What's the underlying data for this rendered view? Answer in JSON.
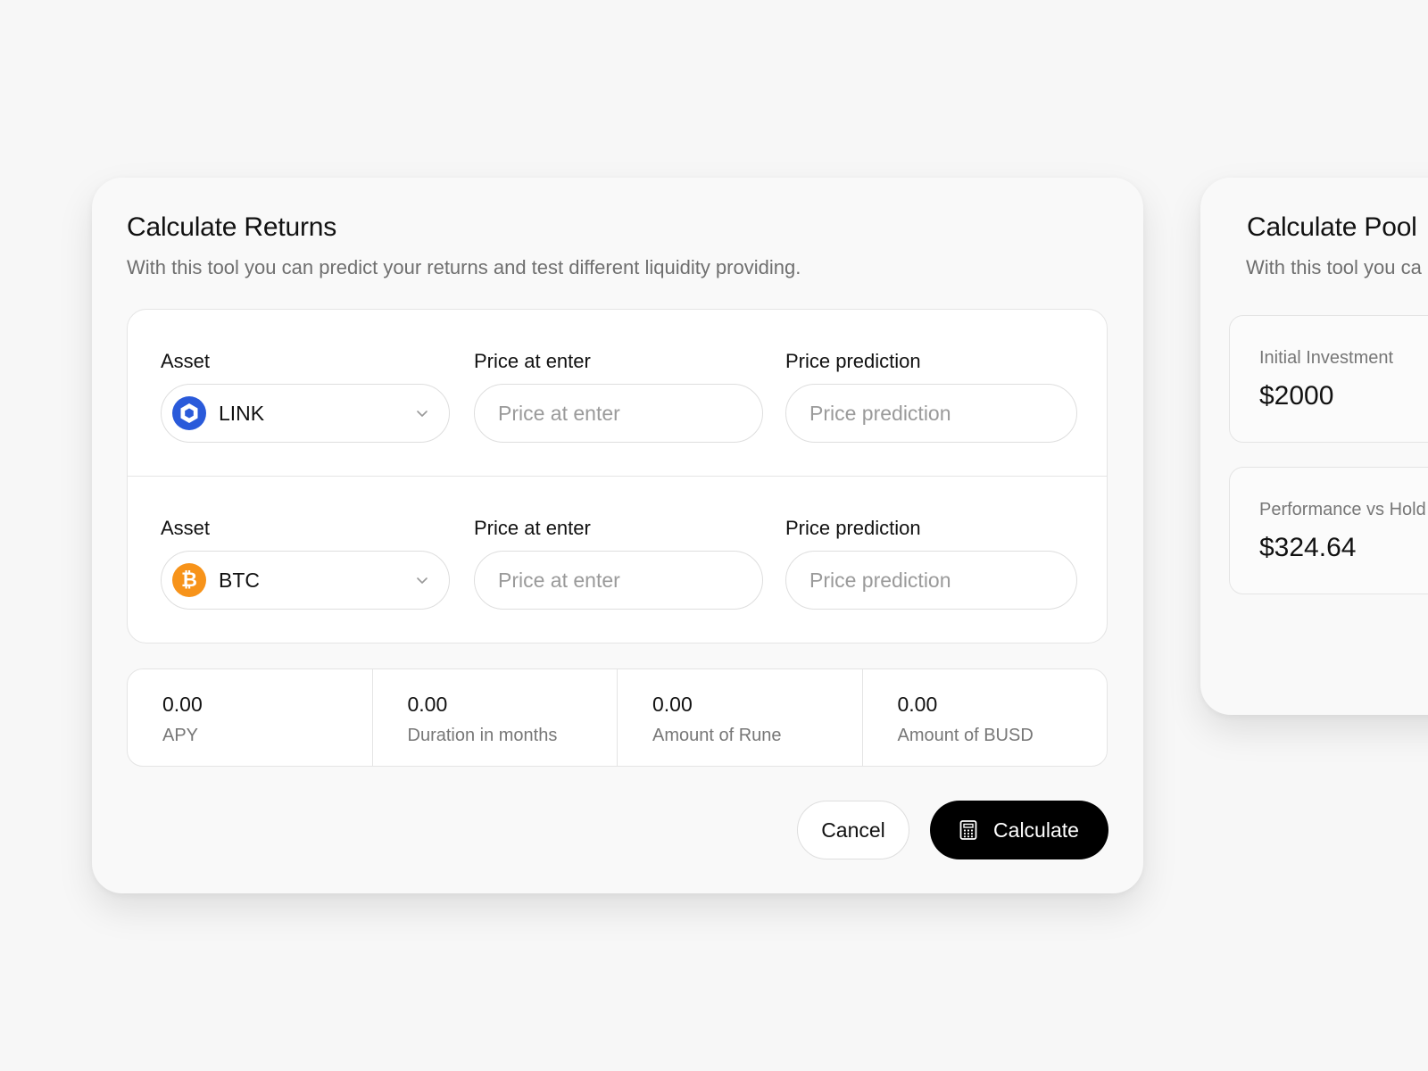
{
  "calculate_returns": {
    "title": "Calculate Returns",
    "subtitle": "With this tool you can predict your returns and test different liquidity providing.",
    "asset_rows": [
      {
        "asset_label": "Asset",
        "asset_value": "LINK",
        "asset_icon": "chainlink-icon",
        "price_enter_label": "Price at enter",
        "price_enter_placeholder": "Price at enter",
        "price_prediction_label": "Price prediction",
        "price_prediction_placeholder": "Price prediction"
      },
      {
        "asset_label": "Asset",
        "asset_value": "BTC",
        "asset_icon": "bitcoin-icon",
        "asset_icon_glyph": "₿",
        "price_enter_label": "Price at enter",
        "price_enter_placeholder": "Price at enter",
        "price_prediction_label": "Price prediction",
        "price_prediction_placeholder": "Price prediction"
      }
    ],
    "stats": [
      {
        "value": "0.00",
        "label": "APY"
      },
      {
        "value": "0.00",
        "label": "Duration in months"
      },
      {
        "value": "0.00",
        "label": "Amount of Rune"
      },
      {
        "value": "0.00",
        "label": "Amount of BUSD"
      }
    ],
    "cancel_label": "Cancel",
    "calculate_label": "Calculate"
  },
  "calculate_pool": {
    "title": "Calculate Pool",
    "subtitle": "With this tool you ca",
    "boxes": [
      {
        "label": "Initial Investment",
        "value": "$2000"
      },
      {
        "label": "Performance vs Hold",
        "value": "$324.64"
      }
    ]
  },
  "colors": {
    "background": "#f7f7f7",
    "link_blue": "#2a5ada",
    "btc_orange": "#f7931a",
    "primary_button": "#000000"
  }
}
